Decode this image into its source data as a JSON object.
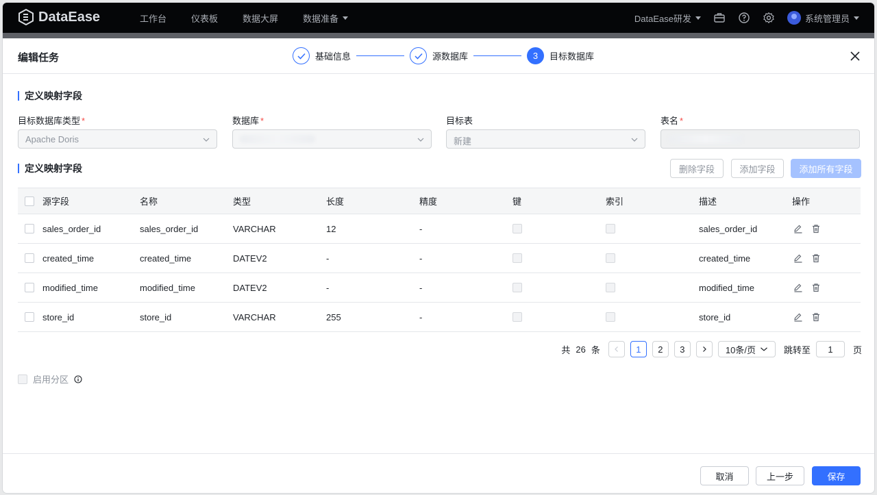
{
  "app": {
    "brand": "DataEase"
  },
  "nav": {
    "items": [
      "工作台",
      "仪表板",
      "数据大屏",
      "数据准备"
    ],
    "workspace": "DataEase研发",
    "user": "系统管理员"
  },
  "dialog": {
    "title": "编辑任务",
    "steps": [
      {
        "label": "基础信息",
        "state": "done"
      },
      {
        "label": "源数据库",
        "state": "done"
      },
      {
        "label": "目标数据库",
        "state": "active",
        "number": "3"
      }
    ]
  },
  "form": {
    "section_title": "定义映射字段",
    "fields": [
      {
        "label": "目标数据库类型",
        "required": true,
        "value": "Apache  Doris"
      },
      {
        "label": "数据库",
        "required": true,
        "value": ""
      },
      {
        "label": "目标表",
        "required": false,
        "value": "新建"
      },
      {
        "label": "表名",
        "required": true,
        "value": ""
      }
    ]
  },
  "mapping": {
    "section_title": "定义映射字段",
    "buttons": {
      "delete": "删除字段",
      "add": "添加字段",
      "add_all": "添加所有字段"
    },
    "columns": [
      "源字段",
      "名称",
      "类型",
      "长度",
      "精度",
      "键",
      "索引",
      "描述",
      "操作"
    ],
    "rows": [
      {
        "source": "sales_order_id",
        "name": "sales_order_id",
        "type": "VARCHAR",
        "length": "12",
        "precision": "-",
        "desc": "sales_order_id"
      },
      {
        "source": "created_time",
        "name": "created_time",
        "type": "DATEV2",
        "length": "-",
        "precision": "-",
        "desc": "created_time"
      },
      {
        "source": "modified_time",
        "name": "modified_time",
        "type": "DATEV2",
        "length": "-",
        "precision": "-",
        "desc": "modified_time"
      },
      {
        "source": "store_id",
        "name": "store_id",
        "type": "VARCHAR",
        "length": "255",
        "precision": "-",
        "desc": "store_id"
      }
    ]
  },
  "pagination": {
    "total_prefix": "共",
    "total": "26",
    "total_suffix": "条",
    "pages": [
      "1",
      "2",
      "3"
    ],
    "page_size": "10条/页",
    "jump_label": "跳转至",
    "jump_value": "1",
    "jump_suffix": "页"
  },
  "partition": {
    "label": "启用分区"
  },
  "footer": {
    "cancel": "取消",
    "prev": "上一步",
    "save": "保存"
  },
  "colors": {
    "primary": "#3370ff",
    "primary_disabled": "#a5c2ff",
    "nav_bg": "#050608"
  }
}
